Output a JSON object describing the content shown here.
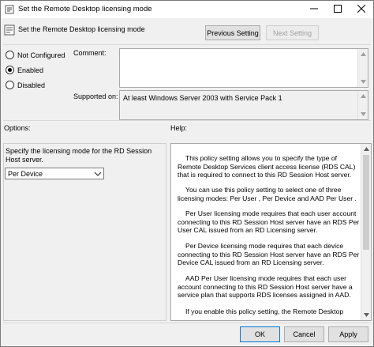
{
  "window": {
    "title": "Set the Remote Desktop licensing mode"
  },
  "header": {
    "title": "Set the Remote Desktop licensing mode",
    "prev_label": "Previous Setting",
    "next_label": "Next Setting"
  },
  "state": {
    "options": [
      {
        "label": "Not Configured",
        "selected": false
      },
      {
        "label": "Enabled",
        "selected": true
      },
      {
        "label": "Disabled",
        "selected": false
      }
    ]
  },
  "comment": {
    "label": "Comment:",
    "value": ""
  },
  "supported": {
    "label": "Supported on:",
    "value": "At least Windows Server 2003 with Service Pack 1"
  },
  "options_section": {
    "label": "Options:",
    "description": "Specify the licensing mode for the RD Session Host server.",
    "mode_value": "Per Device"
  },
  "help": {
    "label": "Help:",
    "paragraphs": [
      "This policy setting allows you to specify the type of Remote Desktop Services client access license (RDS CAL) that is required to connect to this RD Session Host server.",
      "You can use this policy setting to select one of three licensing modes: Per User , Per Device and AAD Per User .",
      "Per User licensing mode requires that each user account connecting to this RD Session Host server have an RDS Per User CAL issued from an RD Licensing server.",
      "Per Device licensing mode requires that each device connecting to this RD Session Host server have an RDS Per Device CAL issued from an RD Licensing server.",
      "AAD Per User licensing mode requires that each user account connecting to this RD Session Host server have a service plan that supports RDS licenses assigned in AAD.",
      "If you enable this policy setting, the Remote Desktop"
    ]
  },
  "footer": {
    "ok_label": "OK",
    "cancel_label": "Cancel",
    "apply_label": "Apply"
  },
  "icons": {
    "title_icon": "policy-icon",
    "header_icon": "policy-icon"
  },
  "colors": {
    "focus_border": "#0078d7",
    "window_bg": "#f0f0f0"
  }
}
